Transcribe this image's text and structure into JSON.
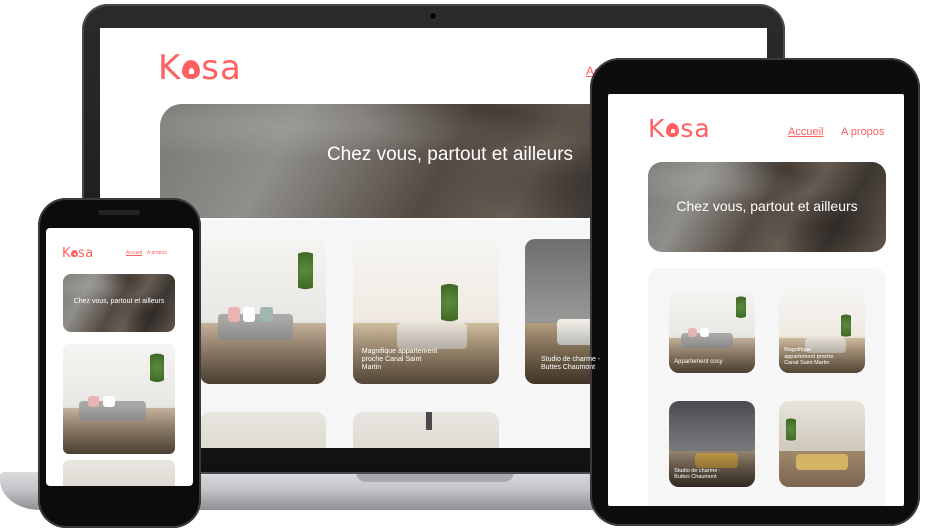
{
  "site": {
    "logo": "Kasa",
    "nav": {
      "home": "Accueil",
      "about": "A propos"
    },
    "banner_text": "Chez vous, partout et ailleurs"
  },
  "laptop": {
    "cards": [
      {
        "caption": ""
      },
      {
        "caption": "Magnifique appartement proche Canal Saint Martin"
      },
      {
        "caption": "Studio de charme - Buttes Chaumont"
      },
      {
        "caption": ""
      },
      {
        "caption": ""
      }
    ]
  },
  "tablet": {
    "cards": [
      {
        "caption": "Appartement cosy"
      },
      {
        "caption": "Magnifique appartement proche Canal Saint Martin"
      },
      {
        "caption": "Studio de charme - Buttes Chaumont"
      },
      {
        "caption": ""
      }
    ]
  },
  "phone": {
    "cards": [
      {
        "caption": ""
      }
    ]
  },
  "colors": {
    "brand": "#ff6060",
    "gallery_bg": "#f6f6f6",
    "device_frame": "#111113"
  },
  "icons": {
    "logo_house": "house-icon"
  }
}
